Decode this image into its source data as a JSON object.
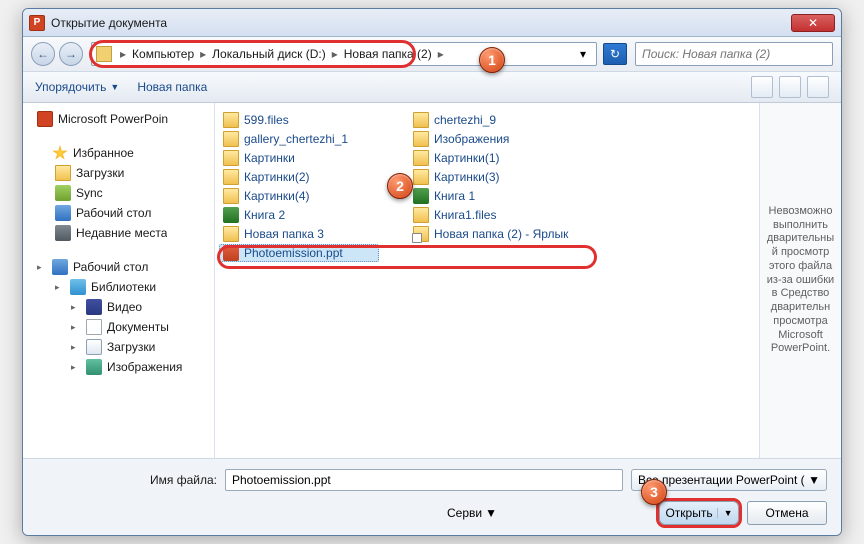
{
  "title": "Открытие документа",
  "nav": {
    "back_glyph": "←",
    "fwd_glyph": "→"
  },
  "address": {
    "segments": [
      "Компьютер",
      "Локальный диск (D:)",
      "Новая папка (2)"
    ],
    "chev": "▸",
    "dropdown": "▾",
    "refresh": "↻"
  },
  "search": {
    "placeholder": "Поиск: Новая папка (2)"
  },
  "toolbar": {
    "organize": "Упорядочить",
    "new_folder": "Новая папка"
  },
  "sidebar": {
    "ppt": "Microsoft PowerPoin",
    "fav_header": "Избранное",
    "downloads": "Загрузки",
    "sync": "Sync",
    "desktop": "Рабочий стол",
    "recent": "Недавние места",
    "desktop2": "Рабочий стол",
    "libraries": "Библиотеки",
    "video": "Видео",
    "documents": "Документы",
    "downloads2": "Загрузки",
    "images": "Изображения"
  },
  "files": {
    "col1": [
      {
        "icon": "folder",
        "name": "599.files"
      },
      {
        "icon": "folder",
        "name": "gallery_chertezhi_1"
      },
      {
        "icon": "folder",
        "name": "Картинки"
      },
      {
        "icon": "folder",
        "name": "Картинки(2)"
      },
      {
        "icon": "folder",
        "name": "Картинки(4)"
      },
      {
        "icon": "excel",
        "name": "Книга 2"
      },
      {
        "icon": "folder",
        "name": "Новая папка 3"
      },
      {
        "icon": "ppt",
        "name": "Photoemission.ppt",
        "selected": true
      }
    ],
    "col2": [
      {
        "icon": "folder",
        "name": "chertezhi_9"
      },
      {
        "icon": "folder",
        "name": "Изображения"
      },
      {
        "icon": "folder",
        "name": "Картинки(1)"
      },
      {
        "icon": "folder",
        "name": "Картинки(3)"
      },
      {
        "icon": "excel",
        "name": "Книга 1"
      },
      {
        "icon": "folder",
        "name": "Книга1.files"
      },
      {
        "icon": "link",
        "name": "Новая папка (2) - Ярлык"
      }
    ]
  },
  "preview": {
    "text": "Невозможно выполнить дварительный просмотр этого файла из-за ошибки в Средство дварительн просмотра Microsoft PowerPoint."
  },
  "footer": {
    "label": "Имя файла:",
    "value": "Photoemission.ppt",
    "filter": "Все презентации PowerPoint (",
    "service": "Серви",
    "open": "Открыть",
    "cancel": "Отмена"
  },
  "badges": {
    "b1": "1",
    "b2": "2",
    "b3": "3"
  }
}
